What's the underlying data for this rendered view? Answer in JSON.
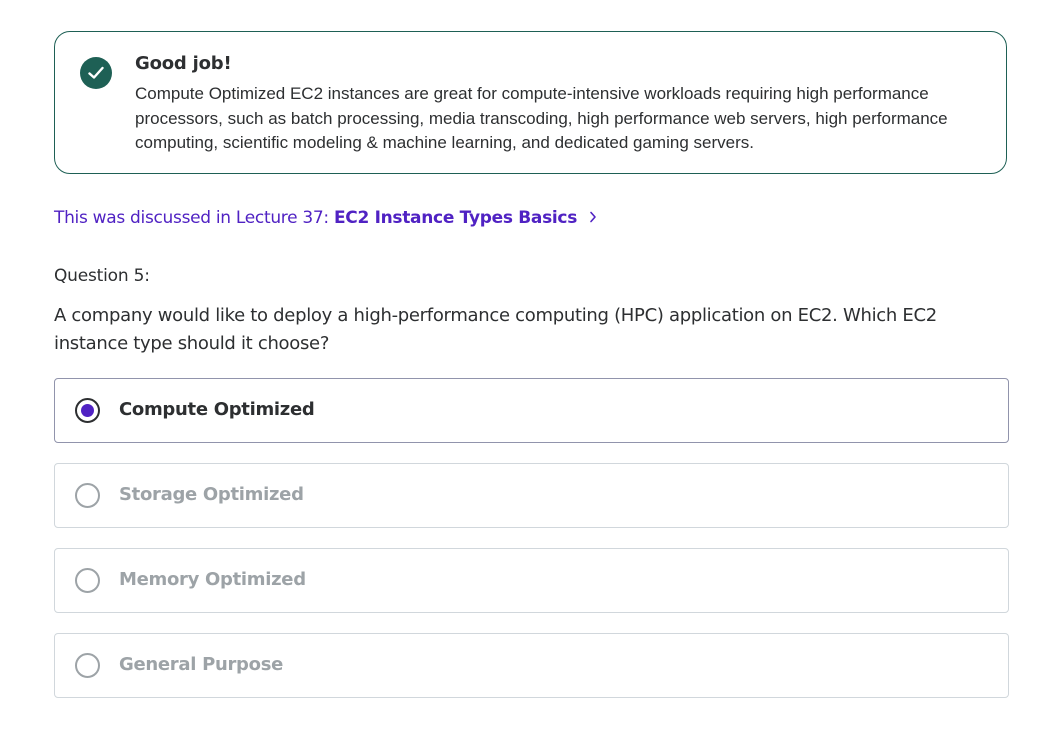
{
  "feedback": {
    "title": "Good job!",
    "body": "Compute Optimized EC2 instances are great for compute-intensive workloads requiring high performance processors, such as batch processing, media transcoding, high performance web servers, high performance computing, scientific modeling & machine learning, and dedicated gaming servers.",
    "icon": "check-circle-icon",
    "accent_color": "#1e6055"
  },
  "reference": {
    "prefix": "This was discussed in Lecture 37: ",
    "lecture_title": "EC2 Instance Types Basics",
    "icon": "chevron-right-icon",
    "color": "#5022c3"
  },
  "question": {
    "number_label": "Question 5:",
    "text": "A company would like to deploy a high-performance computing (HPC) application on EC2. Which EC2 instance type should it choose?"
  },
  "options": [
    {
      "label": "Compute Optimized",
      "selected": true
    },
    {
      "label": "Storage Optimized",
      "selected": false
    },
    {
      "label": "Memory Optimized",
      "selected": false
    },
    {
      "label": "General Purpose",
      "selected": false
    }
  ],
  "colors": {
    "text_primary": "#2d2f31",
    "text_disabled": "#9da3a7",
    "radio_selected": "#5022c3",
    "border": "#d1d7dc"
  }
}
